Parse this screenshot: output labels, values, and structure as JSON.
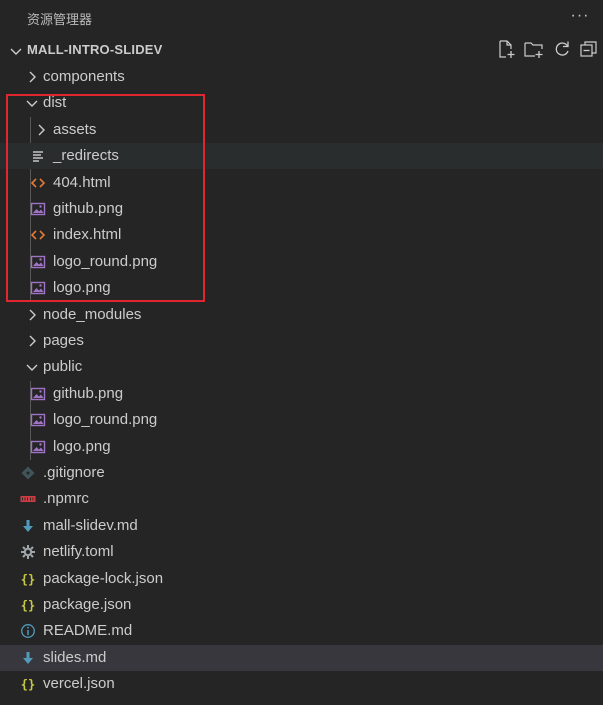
{
  "panel": {
    "title": "资源管理器",
    "more_label": "···"
  },
  "root": {
    "label": "MALL-INTRO-SLIDEV"
  },
  "actions": [
    "new-file",
    "new-folder",
    "refresh",
    "collapse-all"
  ],
  "tree": [
    {
      "label": "components",
      "type": "folder",
      "expanded": false
    },
    {
      "label": "dist",
      "type": "folder",
      "expanded": true
    },
    {
      "label": "assets",
      "type": "folder",
      "expanded": false
    },
    {
      "label": "_redirects",
      "type": "text"
    },
    {
      "label": "404.html",
      "type": "html"
    },
    {
      "label": "github.png",
      "type": "image"
    },
    {
      "label": "index.html",
      "type": "html"
    },
    {
      "label": "logo_round.png",
      "type": "image"
    },
    {
      "label": "logo.png",
      "type": "image"
    },
    {
      "label": "node_modules",
      "type": "folder",
      "expanded": false
    },
    {
      "label": "pages",
      "type": "folder",
      "expanded": false
    },
    {
      "label": "public",
      "type": "folder",
      "expanded": true
    },
    {
      "label": "github.png",
      "type": "image"
    },
    {
      "label": "logo_round.png",
      "type": "image"
    },
    {
      "label": "logo.png",
      "type": "image"
    },
    {
      "label": ".gitignore",
      "type": "git"
    },
    {
      "label": ".npmrc",
      "type": "npm"
    },
    {
      "label": "mall-slidev.md",
      "type": "markdown"
    },
    {
      "label": "netlify.toml",
      "type": "config"
    },
    {
      "label": "package-lock.json",
      "type": "json"
    },
    {
      "label": "package.json",
      "type": "json"
    },
    {
      "label": "README.md",
      "type": "info"
    },
    {
      "label": "slides.md",
      "type": "markdown"
    },
    {
      "label": "vercel.json",
      "type": "json"
    }
  ],
  "colors": {
    "background": "#252526",
    "selection": "#37373d",
    "hover": "#2a2d2e",
    "annotation_box": "#e0262e",
    "html_icon": "#e37933",
    "image_icon": "#a074c4",
    "json_icon": "#cbcb41",
    "markdown_icon": "#519aba",
    "npm_icon": "#cc3e44"
  }
}
